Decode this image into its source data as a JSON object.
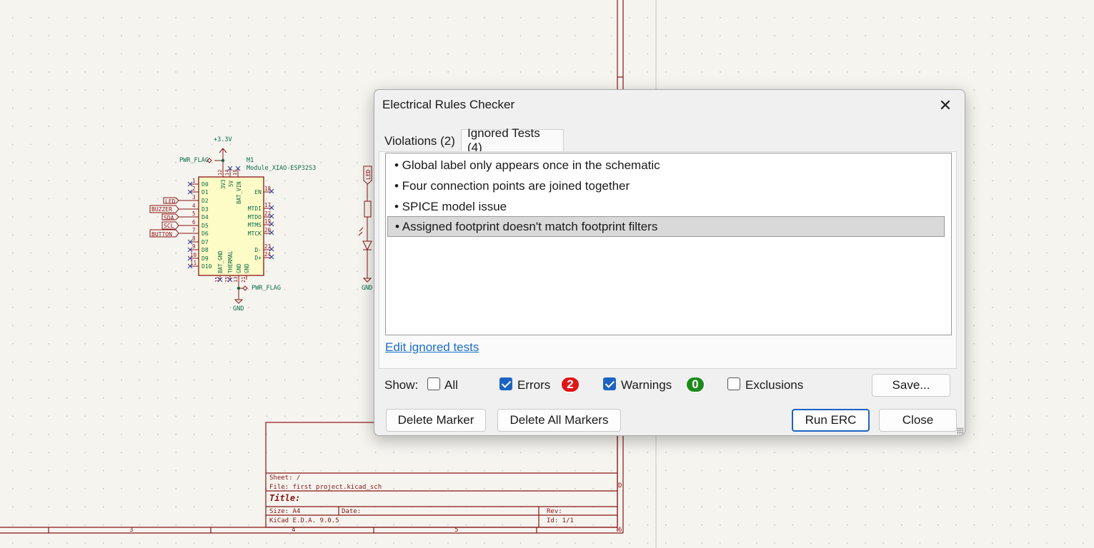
{
  "schematic": {
    "power_label": "+3.3V",
    "ref": "M1",
    "value": "Module_XIAO-ESP32S3",
    "pwr_flag_top": "PWR_FLAG",
    "pwr_flag_bottom": "PWR_FLAG",
    "gnd_label": "GND",
    "gnd_label_led": "GND",
    "led_label": "LED",
    "net_labels": [
      "LED",
      "BUZZER",
      "SDA",
      "SCL",
      "BUTTON"
    ],
    "left_pins": [
      {
        "num": "1",
        "name": "D0"
      },
      {
        "num": "2",
        "name": "D1"
      },
      {
        "num": "3",
        "name": "D2"
      },
      {
        "num": "4",
        "name": "D3"
      },
      {
        "num": "5",
        "name": "D4"
      },
      {
        "num": "6",
        "name": "D5"
      },
      {
        "num": "7",
        "name": "D6"
      },
      {
        "num": "8",
        "name": "D7"
      },
      {
        "num": "9",
        "name": "D8"
      },
      {
        "num": "10",
        "name": "D9"
      },
      {
        "num": "11",
        "name": "D10"
      }
    ],
    "right_pins": [
      {
        "num": "18",
        "name": "EN"
      },
      {
        "num": "17",
        "name": "MTDI"
      },
      {
        "num": "22",
        "name": "MTDO"
      },
      {
        "num": "19",
        "name": "MTMS"
      },
      {
        "num": "20",
        "name": "MTCK"
      },
      {
        "num": "23",
        "name": "D-"
      },
      {
        "num": "24",
        "name": "D+"
      }
    ],
    "top_pins": [
      {
        "num": "12",
        "name": "3V3"
      },
      {
        "num": "14",
        "name": "5V"
      },
      {
        "num": "16",
        "name": "BAT_VIN"
      }
    ],
    "bottom_pins": [
      {
        "num": "15",
        "name": "BAT_GND"
      },
      {
        "num": "25",
        "name": "THERMAL"
      },
      {
        "num": "13",
        "name": "GND"
      },
      {
        "num": "21",
        "name": "GND"
      }
    ],
    "title_block": {
      "sheet": "Sheet: /",
      "file": "File: first project.kicad_sch",
      "title": "Title:",
      "size": "Size: A4",
      "date": "Date:",
      "rev": "Rev:",
      "tool": "KiCad E.D.A. 9.0.5",
      "id": "Id: 1/1"
    },
    "border_numbers": [
      "3",
      "4",
      "5",
      "6"
    ],
    "border_letter": "D"
  },
  "dialog": {
    "title": "Electrical Rules Checker",
    "tabs": [
      {
        "label": "Violations (2)",
        "active": false
      },
      {
        "label": "Ignored Tests (4)",
        "active": true
      }
    ],
    "ignored_items": [
      {
        "text": "• Global label only appears once in the schematic",
        "selected": false
      },
      {
        "text": "• Four connection points are joined together",
        "selected": false
      },
      {
        "text": "• SPICE model issue",
        "selected": false
      },
      {
        "text": "• Assigned footprint doesn't match footprint filters",
        "selected": true
      }
    ],
    "edit_link": "Edit ignored tests",
    "show_label": "Show:",
    "filters": {
      "all": {
        "label": "All",
        "checked": false
      },
      "errors": {
        "label": "Errors",
        "checked": true,
        "count": "2",
        "color": "#e01515"
      },
      "warnings": {
        "label": "Warnings",
        "checked": true,
        "count": "0",
        "color": "#1e8a1e"
      },
      "exclusions": {
        "label": "Exclusions",
        "checked": false
      }
    },
    "buttons": {
      "save": "Save...",
      "delete_marker": "Delete Marker",
      "delete_all": "Delete All Markers",
      "run_erc": "Run ERC",
      "close": "Close"
    }
  }
}
